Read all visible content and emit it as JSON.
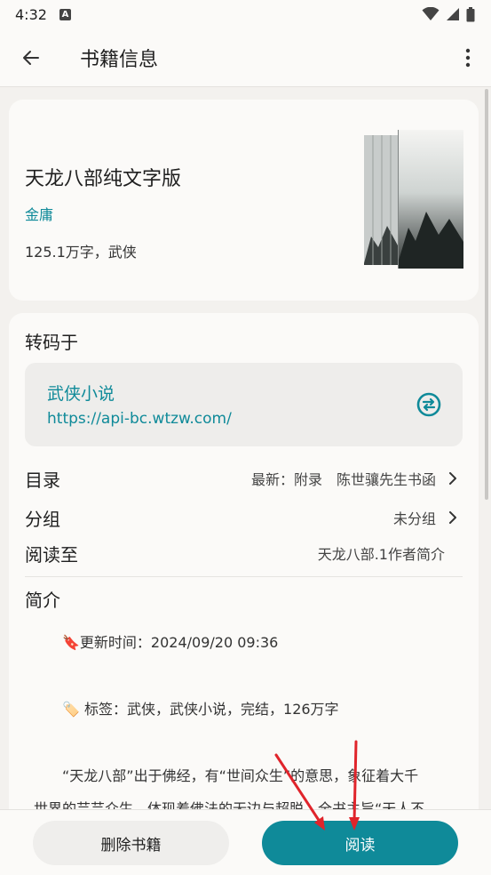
{
  "status_bar": {
    "time": "4:32",
    "notification_letter": "A"
  },
  "app_bar": {
    "title": "书籍信息"
  },
  "book": {
    "title": "天龙八部纯文字版",
    "author": "金庸",
    "meta": "125.1万字，武侠",
    "cover_icon": "book-cover-image"
  },
  "source": {
    "label": "转码于",
    "name": "武侠小说",
    "url": "https://api-bc.wtzw.com/"
  },
  "rows": {
    "toc": {
      "label": "目录",
      "value": "最新：附录　陈世骧先生书函"
    },
    "group": {
      "label": "分组",
      "value": "未分组"
    },
    "progress": {
      "label": "阅读至",
      "value": "天龙八部.1作者简介"
    }
  },
  "intro": {
    "label": "简介",
    "lines": [
      "🔖更新时间：2024/09/20 09:36",
      "🏷️ 标签：武侠，武侠小说，完结，126万字",
      "“天龙八部”出于佛经，有“世间众生”的意思，象征着大千",
      "世界的芸芸众生，体现着佛法的无边与超脱。全书主旨“天人不"
    ]
  },
  "actions": {
    "delete_label": "删除书籍",
    "read_label": "阅读"
  },
  "colors": {
    "accent": "#0f8a99",
    "annotation_arrow": "#e0242b"
  }
}
